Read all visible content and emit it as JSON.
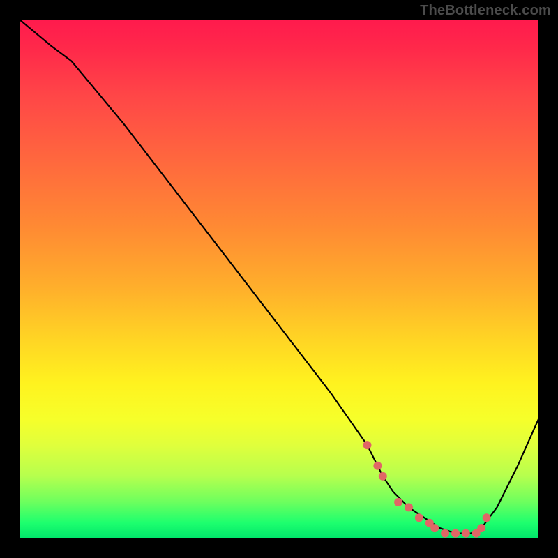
{
  "watermark": "TheBottleneck.com",
  "chart_data": {
    "type": "line",
    "title": "",
    "xlabel": "",
    "ylabel": "",
    "xlim": [
      0,
      100
    ],
    "ylim": [
      0,
      100
    ],
    "series": [
      {
        "name": "curve",
        "x": [
          0,
          6,
          10,
          20,
          30,
          40,
          50,
          60,
          67,
          70,
          72,
          75,
          78,
          81,
          84,
          87,
          89,
          92,
          96,
          100
        ],
        "y": [
          100,
          95,
          92,
          80,
          67,
          54,
          41,
          28,
          18,
          12,
          9,
          6,
          4,
          2,
          1,
          1,
          2,
          6,
          14,
          23
        ]
      }
    ],
    "markers": {
      "name": "dots",
      "color": "#e06666",
      "radius": 6,
      "x": [
        67,
        69,
        70,
        73,
        75,
        77,
        79,
        80,
        82,
        84,
        86,
        88,
        89,
        90
      ],
      "y": [
        18,
        14,
        12,
        7,
        6,
        4,
        3,
        2,
        1,
        1,
        1,
        1,
        2,
        4
      ]
    }
  }
}
